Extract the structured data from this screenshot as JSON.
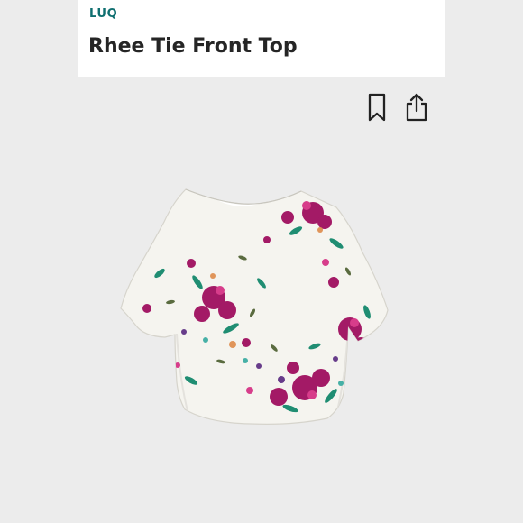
{
  "product": {
    "brand": "LUQ",
    "title": "Rhee Tie Front Top"
  },
  "actions": {
    "bookmark_icon": "bookmark-icon",
    "share_icon": "share-icon"
  },
  "colors": {
    "brand": "#0f6f70",
    "title": "#252525",
    "background": "#ececec",
    "card": "#ffffff",
    "garment": "#f5f4ef"
  }
}
